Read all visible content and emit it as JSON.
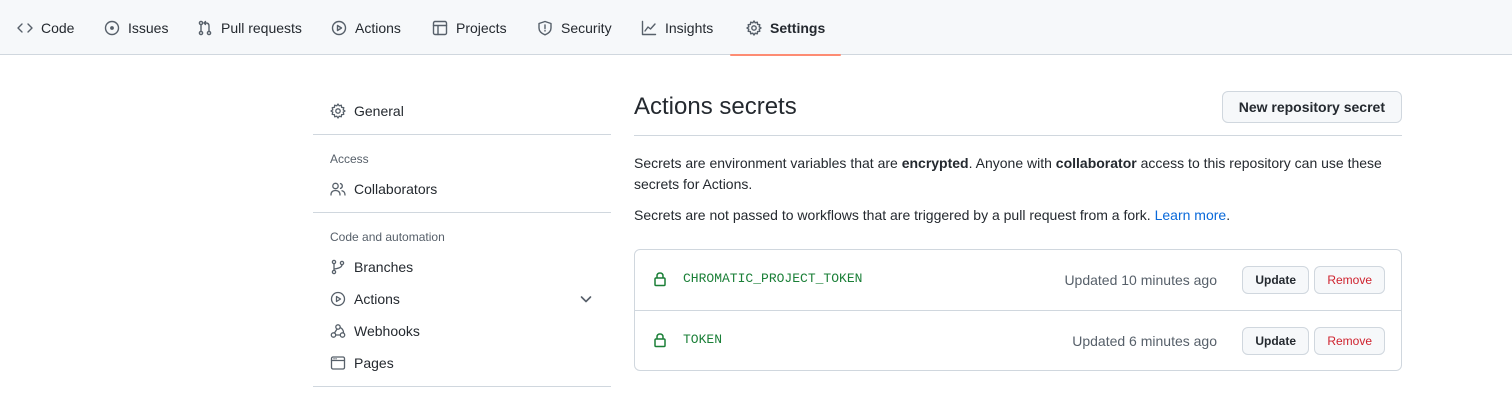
{
  "repo_nav": {
    "tabs": [
      {
        "label": "Code",
        "icon": "code-icon"
      },
      {
        "label": "Issues",
        "icon": "issue-icon"
      },
      {
        "label": "Pull requests",
        "icon": "pull-request-icon"
      },
      {
        "label": "Actions",
        "icon": "play-icon"
      },
      {
        "label": "Projects",
        "icon": "table-icon"
      },
      {
        "label": "Security",
        "icon": "shield-icon"
      },
      {
        "label": "Insights",
        "icon": "graph-icon"
      },
      {
        "label": "Settings",
        "icon": "gear-icon",
        "selected": true
      }
    ]
  },
  "sidebar": {
    "general": "General",
    "access_heading": "Access",
    "collaborators": "Collaborators",
    "code_automation_heading": "Code and automation",
    "branches": "Branches",
    "actions": "Actions",
    "webhooks": "Webhooks",
    "pages": "Pages"
  },
  "main": {
    "title": "Actions secrets",
    "new_button": "New repository secret",
    "desc1": {
      "part1": "Secrets are environment variables that are ",
      "bold1": "encrypted",
      "part2": ". Anyone with ",
      "bold2": "collaborator",
      "part3": " access to this repository can use these secrets for Actions."
    },
    "desc2": {
      "text": "Secrets are not passed to workflows that are triggered by a pull request from a fork. ",
      "link": "Learn more",
      "end": "."
    },
    "secrets": [
      {
        "name": "CHROMATIC_PROJECT_TOKEN",
        "updated": "Updated 10 minutes ago",
        "update_label": "Update",
        "remove_label": "Remove"
      },
      {
        "name": "TOKEN",
        "updated": "Updated 6 minutes ago",
        "update_label": "Update",
        "remove_label": "Remove"
      }
    ]
  },
  "colors": {
    "accent_underline": "#fd8c73",
    "secret_green": "#1a7f37",
    "danger_red": "#cf222e",
    "link_blue": "#0969da"
  }
}
